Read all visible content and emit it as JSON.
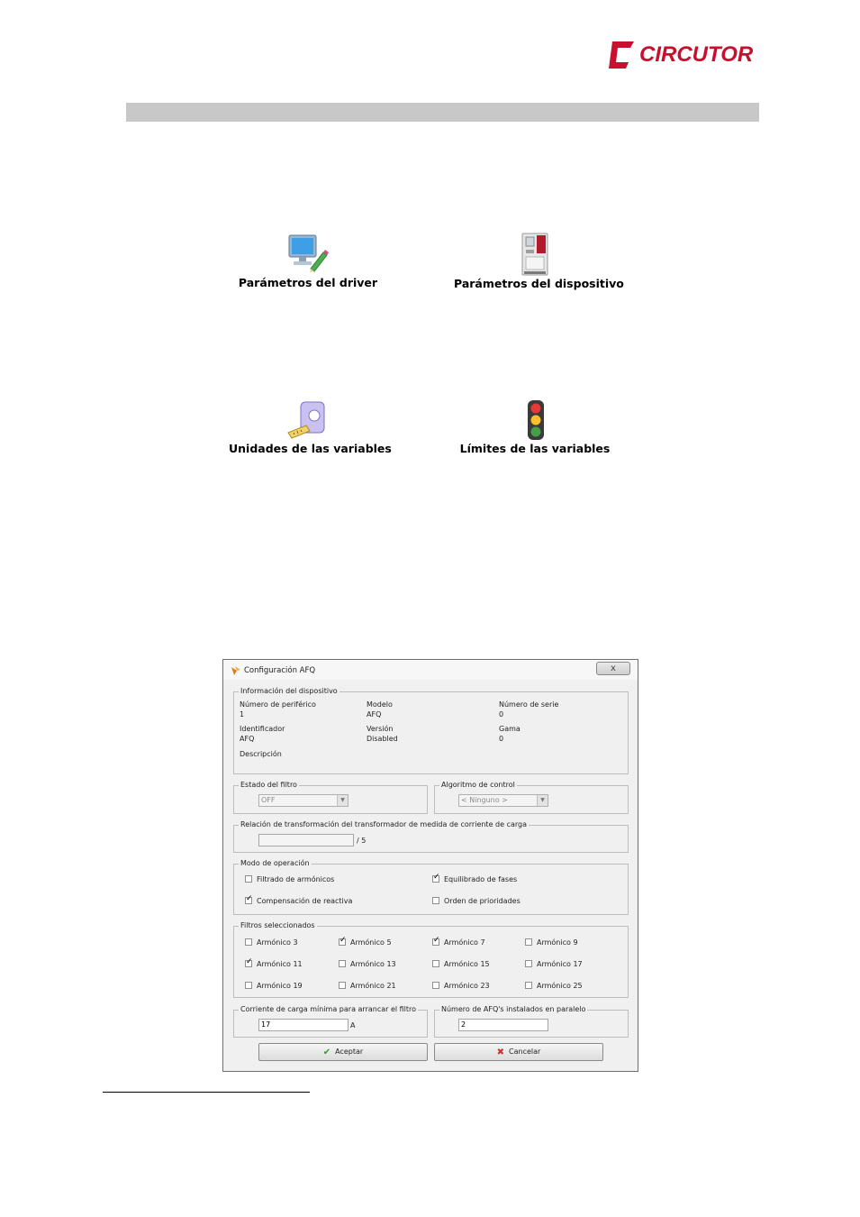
{
  "brand": {
    "logo_text": "CIRCUTOR",
    "accent_color": "#c8102e"
  },
  "header_bar_color": "#c8c8c8",
  "icons": [
    {
      "icon": "monitor-edit-icon",
      "label": "Parámetros del driver"
    },
    {
      "icon": "device-cabinet-icon",
      "label": "Parámetros del dispositivo"
    },
    {
      "icon": "ruler-units-icon",
      "label": "Unidades de las variables"
    },
    {
      "icon": "traffic-light-icon",
      "label": "Límites de las variables"
    }
  ],
  "dialog": {
    "title": "Configuración AFQ",
    "close_label": "x",
    "device_info": {
      "legend": "Información del dispositivo",
      "peripheral_label": "Número de periférico",
      "peripheral_value": "1",
      "model_label": "Modelo",
      "model_value": "AFQ",
      "serial_label": "Número de serie",
      "serial_value": "0",
      "identifier_label": "Identificador",
      "identifier_value": "AFQ",
      "version_label": "Versión",
      "version_value": "Disabled",
      "range_label": "Gama",
      "range_value": "0",
      "description_label": "Descripción"
    },
    "filter_state": {
      "legend": "Estado del filtro",
      "value": "OFF"
    },
    "control_algorithm": {
      "legend": "Algoritmo de control",
      "value": "< Ninguno >"
    },
    "transformer_ratio": {
      "legend": "Relación de transformación del transformador de medida de corriente de carga",
      "value": "",
      "suffix": "/ 5"
    },
    "operation_mode": {
      "legend": "Modo de operación",
      "options": [
        {
          "label": "Filtrado de armónicos",
          "checked": false
        },
        {
          "label": "Equilibrado de fases",
          "checked": true
        },
        {
          "label": "Compensación de reactiva",
          "checked": true
        },
        {
          "label": "Orden de prioridades",
          "checked": false
        }
      ]
    },
    "selected_filters": {
      "legend": "Filtros seleccionados",
      "options": [
        {
          "label": "Armónico 3",
          "checked": false
        },
        {
          "label": "Armónico 5",
          "checked": true
        },
        {
          "label": "Armónico 7",
          "checked": true
        },
        {
          "label": "Armónico 9",
          "checked": false
        },
        {
          "label": "Armónico 11",
          "checked": true
        },
        {
          "label": "Armónico 13",
          "checked": false
        },
        {
          "label": "Armónico 15",
          "checked": false
        },
        {
          "label": "Armónico 17",
          "checked": false
        },
        {
          "label": "Armónico 19",
          "checked": false
        },
        {
          "label": "Armónico 21",
          "checked": false
        },
        {
          "label": "Armónico 23",
          "checked": false
        },
        {
          "label": "Armónico 25",
          "checked": false
        }
      ]
    },
    "min_load_current": {
      "legend": "Corriente de carga mínima para arrancar el filtro",
      "value": "17",
      "unit": "A"
    },
    "afq_parallel": {
      "legend": "Número de AFQ's instalados en paralelo",
      "value": "2"
    },
    "accept_label": "Aceptar",
    "cancel_label": "Cancelar"
  }
}
